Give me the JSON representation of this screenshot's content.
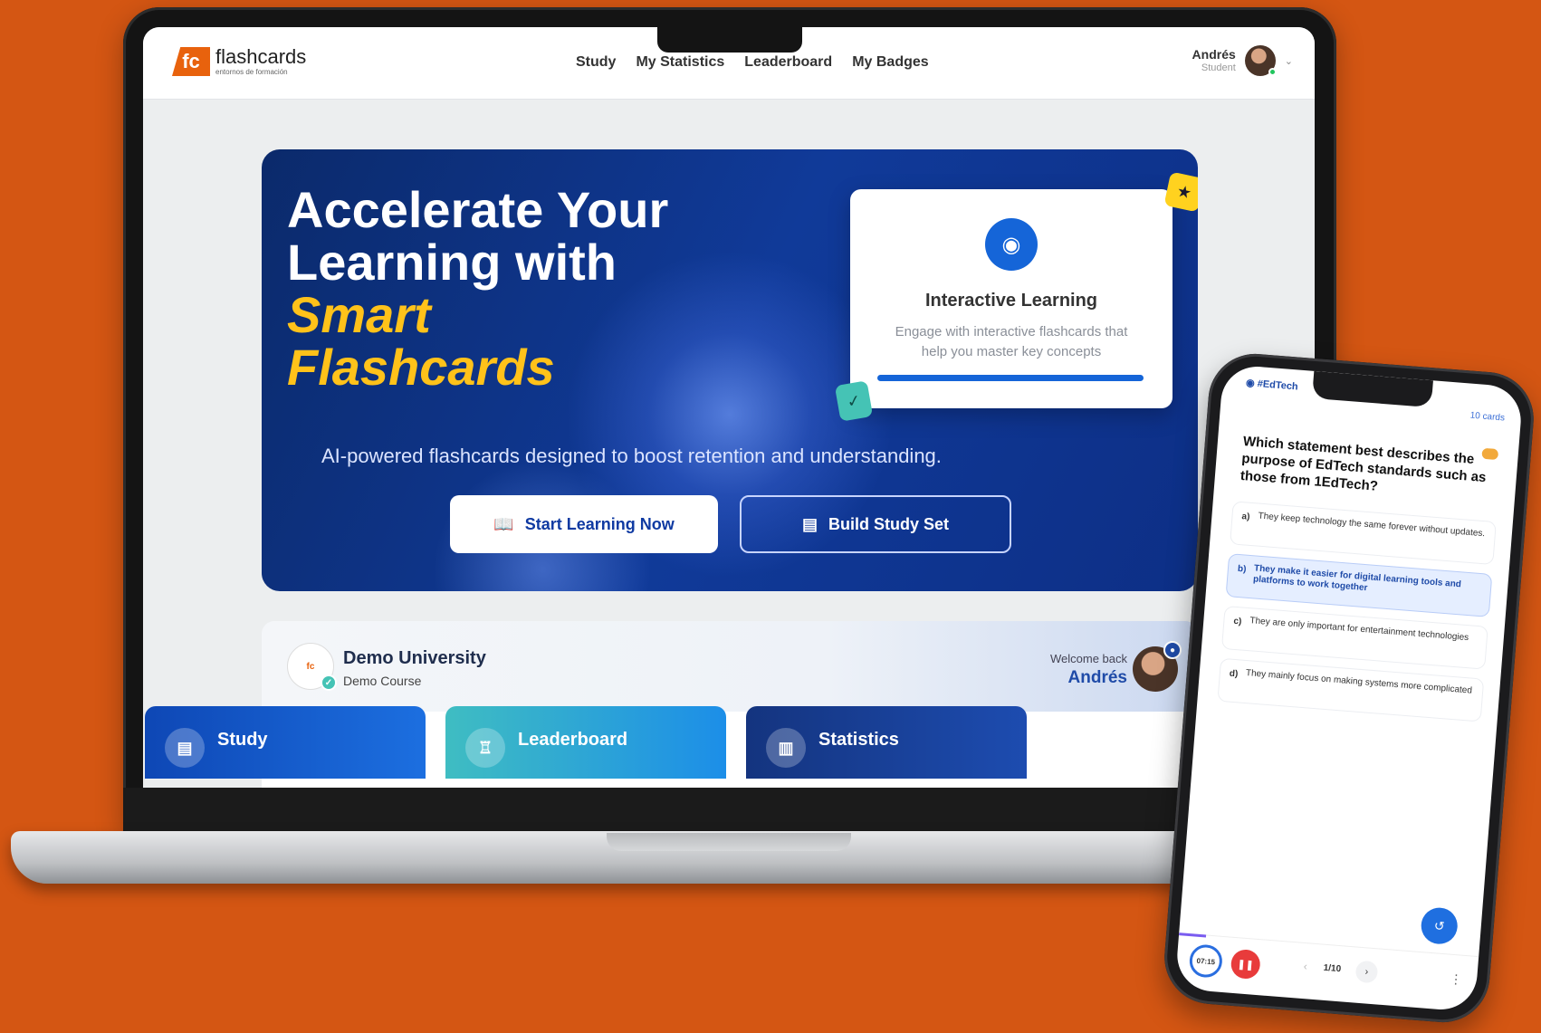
{
  "nav": {
    "logo_mark": "fc",
    "logo_name": "flashcards",
    "logo_tag": "entornos de formación",
    "items": [
      "Study",
      "My Statistics",
      "Leaderboard",
      "My Badges"
    ],
    "user_name": "Andrés",
    "user_role": "Student"
  },
  "hero": {
    "title_line1": "Accelerate Your",
    "title_line2": "Learning with",
    "title_accent1": "Smart",
    "title_accent2": "Flashcards",
    "subtitle": "AI-powered flashcards designed to boost retention and understanding.",
    "primary_button": "Start Learning Now",
    "secondary_button": "Build Study Set",
    "card_title": "Interactive Learning",
    "card_desc": "Engage with interactive flashcards that help you master key concepts"
  },
  "course": {
    "name": "Demo University",
    "sub": "Demo Course",
    "welcome_label": "Welcome back",
    "welcome_name": "Andrés"
  },
  "tiles": [
    "Study",
    "Leaderboard",
    "Statistics"
  ],
  "phone": {
    "tag": "#EdTech",
    "count": "10 cards",
    "question": "Which statement best describes the purpose of EdTech standards such as those from 1EdTech?",
    "options": [
      {
        "letter": "a)",
        "text": "They keep technology the same forever without updates."
      },
      {
        "letter": "b)",
        "text": "They make it easier for digital learning tools and platforms to work together"
      },
      {
        "letter": "c)",
        "text": "They are only important for entertainment technologies"
      },
      {
        "letter": "d)",
        "text": "They mainly focus on making systems more complicated"
      }
    ],
    "selected_option": 1,
    "timer": "07:15",
    "page": "1/10"
  },
  "colors": {
    "background": "#d45613",
    "brand_orange": "#e8620d",
    "hero_blue": "#103a99",
    "accent_yellow": "#ffc21a",
    "primary_blue": "#1565d8"
  }
}
